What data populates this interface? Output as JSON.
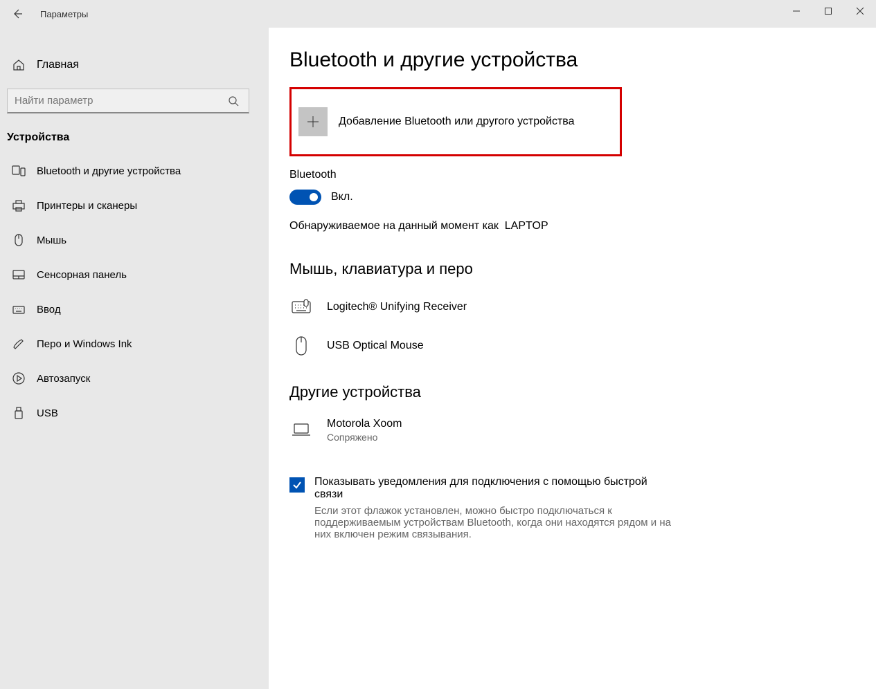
{
  "window": {
    "title": "Параметры"
  },
  "sidebar": {
    "home": "Главная",
    "search_placeholder": "Найти параметр",
    "category": "Устройства",
    "items": [
      {
        "label": "Bluetooth и другие устройства"
      },
      {
        "label": "Принтеры и сканеры"
      },
      {
        "label": "Мышь"
      },
      {
        "label": "Сенсорная панель"
      },
      {
        "label": "Ввод"
      },
      {
        "label": "Перо и Windows Ink"
      },
      {
        "label": "Автозапуск"
      },
      {
        "label": "USB"
      }
    ]
  },
  "main": {
    "page_title": "Bluetooth и другие устройства",
    "add_device_label": "Добавление Bluetooth или другого устройства",
    "bluetooth_label": "Bluetooth",
    "toggle_state": "Вкл.",
    "discoverable_text": "Обнаруживаемое на данный момент как",
    "discoverable_name": "LAPTOP",
    "section_mouse_kb": "Мышь, клавиатура и перо",
    "devices_mkp": [
      {
        "name": "Logitech® Unifying Receiver"
      },
      {
        "name": "USB Optical Mouse"
      }
    ],
    "section_other": "Другие устройства",
    "devices_other": [
      {
        "name": "Motorola Xoom",
        "status": "Сопряжено"
      }
    ],
    "checkbox_label": "Показывать уведомления для подключения с помощью быстрой связи",
    "checkbox_desc": "Если этот флажок установлен, можно быстро подключаться к поддерживаемым устройствам Bluetooth, когда они находятся рядом и на них включен режим связывания."
  }
}
